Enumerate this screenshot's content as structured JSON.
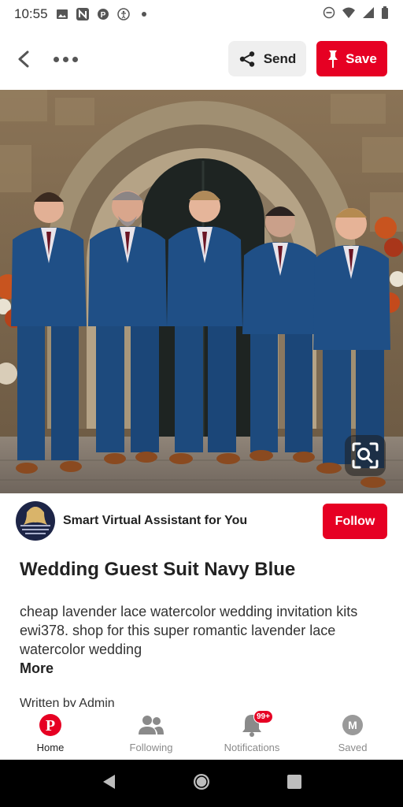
{
  "status_bar": {
    "time": "10:55",
    "left_icons": [
      "image-icon",
      "n-app-icon",
      "pinterest-icon",
      "accessibility-icon",
      "dot-icon"
    ],
    "right_icons": [
      "do-not-disturb-icon",
      "wifi-icon",
      "signal-icon",
      "battery-icon"
    ]
  },
  "top_bar": {
    "back_icon": "chevron-left-icon",
    "more_icon": "more-dots-icon",
    "send_label": "Send",
    "save_label": "Save",
    "accent_color": "#e60023"
  },
  "pin": {
    "lens_icon": "visual-search-icon",
    "creator_name": "Smart Virtual Assistant for You",
    "follow_label": "Follow",
    "title": "Wedding Guest Suit Navy Blue",
    "description": "cheap lavender lace watercolor wedding invitation kits ewi378. shop for this super romantic lavender lace watercolor wedding",
    "more_label": "More",
    "written_by": "Written by Admin"
  },
  "bottom_nav": {
    "items": [
      {
        "label": "Home",
        "icon": "pinterest-logo-icon",
        "active": true
      },
      {
        "label": "Following",
        "icon": "people-icon",
        "active": false
      },
      {
        "label": "Notifications",
        "icon": "bell-icon",
        "active": false,
        "badge": "99+"
      },
      {
        "label": "Saved",
        "icon": "profile-avatar-icon",
        "active": false,
        "avatar_letter": "M"
      }
    ]
  },
  "system_nav": {
    "icons": [
      "back-triangle-icon",
      "home-circle-icon",
      "recents-square-icon"
    ]
  }
}
